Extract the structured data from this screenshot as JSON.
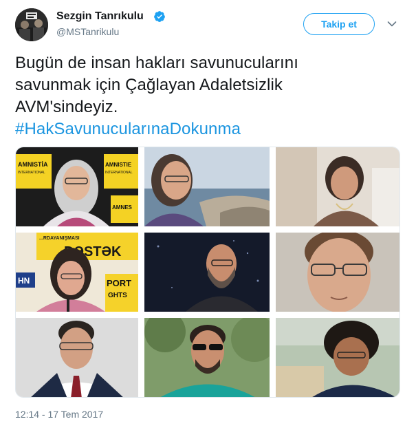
{
  "author": {
    "name": "Sezgin Tanrıkulu",
    "handle": "@MSTanrikulu",
    "verified_icon": "verified-badge-icon"
  },
  "actions": {
    "follow_label": "Takip et",
    "menu_icon": "chevron-down-icon"
  },
  "tweet": {
    "line1": "Bugün de insan hakları savunucularını",
    "line2": "savunmak için Çağlayan Adaletsizlik",
    "line3": "AVM'sindeyiz.",
    "hashtag": "#HakSavunucularınaDokunma"
  },
  "photos": {
    "p1_sign_left": "AMNISTİA",
    "p1_sign_left_sub": "INTERNATIONAL",
    "p1_sign_right": "AMNISTIE",
    "p1_sign_right_sub": "INTERNATIONAL",
    "p1_sign_bottom": "AMNES",
    "p4_banner": "DƏSTƏK",
    "p4_banner_top": "...RDAYANIŞMASI",
    "p4_sign_left": "HN",
    "p4_sign_right": "PORT",
    "p4_sign_right_sub": "GHTS"
  },
  "meta": {
    "timestamp": "12:14 - 17 Tem 2017"
  },
  "colors": {
    "accent": "#1da1f2",
    "hashtag": "#1b95e0",
    "secondary_text": "#657786"
  }
}
